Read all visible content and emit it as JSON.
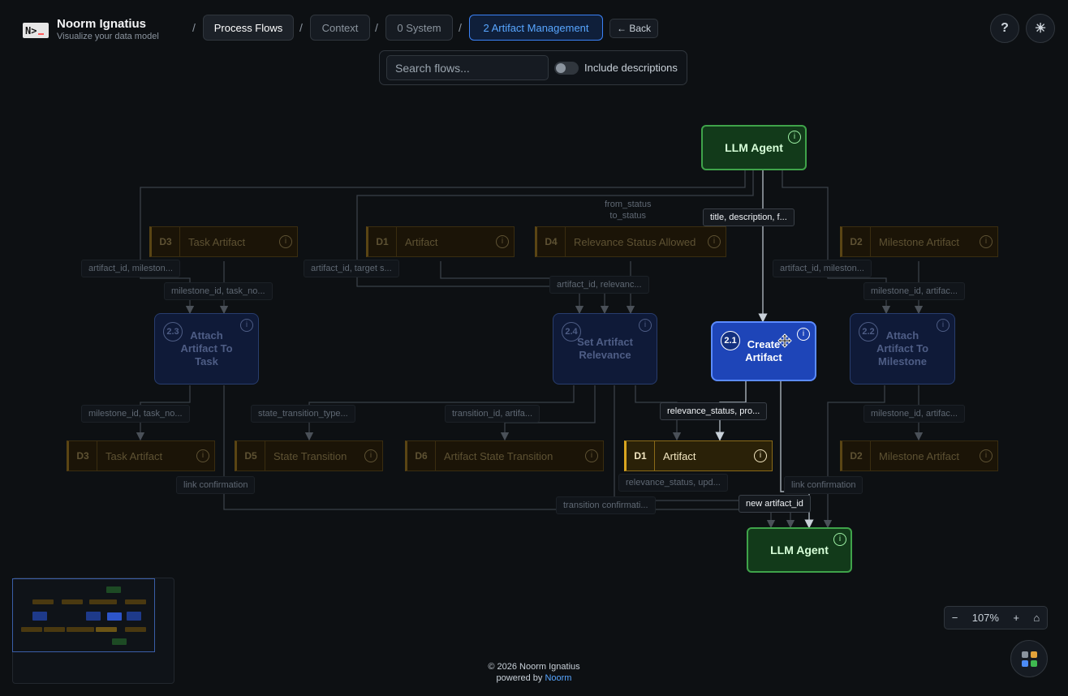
{
  "header": {
    "logo_text": "N>",
    "app_title": "Noorm Ignatius",
    "app_subtitle": "Visualize your data model",
    "breadcrumbs": [
      "Process Flows",
      "Context",
      "0 System",
      "2 Artifact Management"
    ],
    "separator": "/",
    "back_label": "← Back",
    "help_label": "?",
    "theme_label": "☀"
  },
  "search": {
    "placeholder": "Search flows...",
    "toggle_label": "Include descriptions",
    "toggle_on": false
  },
  "diagram": {
    "agent_top": {
      "label": "LLM Agent",
      "info": "i"
    },
    "agent_bottom": {
      "label": "LLM Agent",
      "info": "i"
    },
    "processes": [
      {
        "id": "2.3",
        "label": "Attach Artifact To Task",
        "active": false
      },
      {
        "id": "2.4",
        "label": "Set Artifact Relevance",
        "active": false
      },
      {
        "id": "2.1",
        "label": "Create Artifact",
        "active": true
      },
      {
        "id": "2.2",
        "label": "Attach Artifact To Milestone",
        "active": false
      }
    ],
    "datastores_top": [
      {
        "id": "D3",
        "label": "Task Artifact"
      },
      {
        "id": "D1",
        "label": "Artifact"
      },
      {
        "id": "D4",
        "label": "Relevance Status Allowed"
      },
      {
        "id": "D2",
        "label": "Milestone Artifact"
      }
    ],
    "datastores_bottom": [
      {
        "id": "D3",
        "label": "Task Artifact"
      },
      {
        "id": "D5",
        "label": "State Transition"
      },
      {
        "id": "D6",
        "label": "Artifact State Transition"
      },
      {
        "id": "D1",
        "label": "Artifact",
        "highlight": true
      },
      {
        "id": "D2",
        "label": "Milestone Artifact"
      }
    ],
    "edge_labels": {
      "from_status": "from_status",
      "to_status": "to_status",
      "title_desc": "title, description, f...",
      "artifact_mileston_left": "artifact_id, mileston...",
      "milestone_task_top": "milestone_id, task_no...",
      "artifact_target": "artifact_id, target s...",
      "artifact_relevanc": "artifact_id, relevanc...",
      "artifact_mileston_right": "artifact_id, mileston...",
      "milestone_artifac_top": "milestone_id, artifac...",
      "milestone_task_bottom": "milestone_id, task_no...",
      "state_transition_type": "state_transition_type...",
      "transition_artifa": "transition_id, artifa...",
      "relevance_status_pro": "relevance_status, pro...",
      "milestone_artifac_bottom": "milestone_id, artifac...",
      "link_confirmation_left": "link confirmation",
      "relevance_status_upd": "relevance_status, upd...",
      "link_confirmation_right": "link confirmation",
      "transition_confirmati": "transition confirmati...",
      "new_artifact_id": "new artifact_id"
    }
  },
  "zoom": {
    "minus": "−",
    "level": "107%",
    "plus": "+",
    "home": "⌂"
  },
  "footer": {
    "copyright": "© 2026 Noorm Ignatius",
    "powered_prefix": "powered by",
    "powered_brand": "Noorm"
  },
  "colors": {
    "background": "#0d1013",
    "accent": "#58a6ff",
    "agent": "#3fa34a",
    "process_active": "#1e45b8",
    "datastore_highlight": "#d9a520"
  }
}
